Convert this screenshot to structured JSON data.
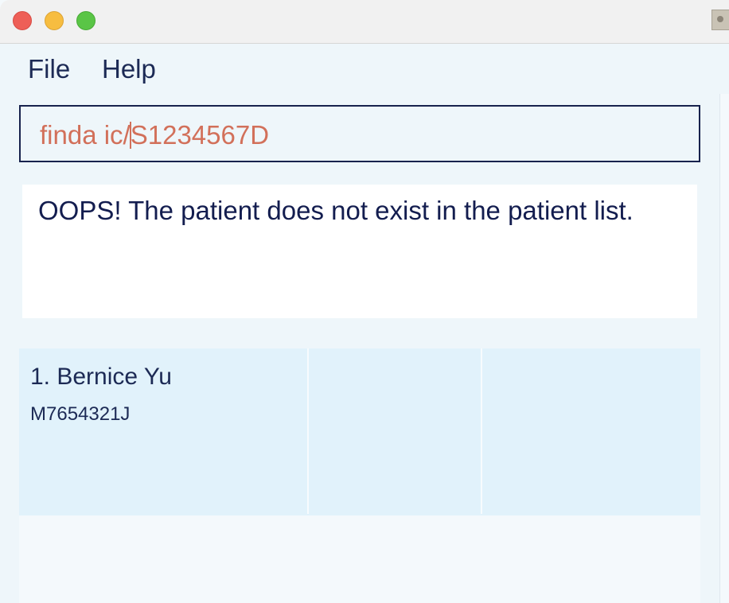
{
  "window": {
    "controls": [
      "close",
      "minimize",
      "maximize"
    ],
    "corner_icon": "contact-card-icon"
  },
  "menu": {
    "file_label": "File",
    "help_label": "Help"
  },
  "command": {
    "text_before_caret": "finda ic/",
    "text_after_caret": "S1234567D"
  },
  "result": {
    "message": "OOPS! The patient does not exist in the patient list."
  },
  "patients": [
    {
      "name": "1. Bernice Yu",
      "ic": "M7654321J"
    }
  ],
  "colors": {
    "command_text": "#d2705a",
    "text_primary": "#1c2a55",
    "card_background": "#e1f2fb"
  }
}
